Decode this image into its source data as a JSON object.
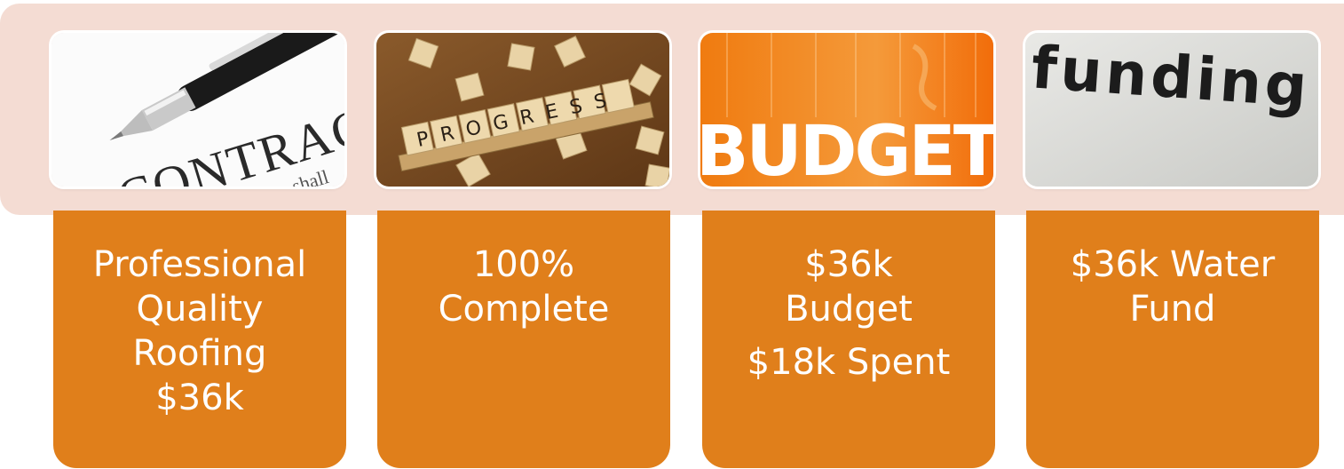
{
  "tiles": [
    {
      "icon": "contract-pen-image",
      "image_text": "CONTRACT",
      "image_subtext": "shall",
      "lines": [
        "Professional",
        "Quality",
        "Roofing",
        "$36k"
      ]
    },
    {
      "icon": "progress-scrabble-image",
      "image_text": "PROGRESS",
      "lines": [
        "100%",
        "Complete"
      ]
    },
    {
      "icon": "budget-letters-image",
      "image_text": "BUDGET",
      "lines": [
        "$36k",
        "Budget"
      ],
      "extra_line": "$18k Spent"
    },
    {
      "icon": "funding-letters-image",
      "image_text": "funding",
      "lines": [
        "$36k Water",
        "Fund"
      ]
    }
  ],
  "colors": {
    "band": "#f4dcd3",
    "card": "#e07f1b",
    "card_text": "#ffffff"
  }
}
